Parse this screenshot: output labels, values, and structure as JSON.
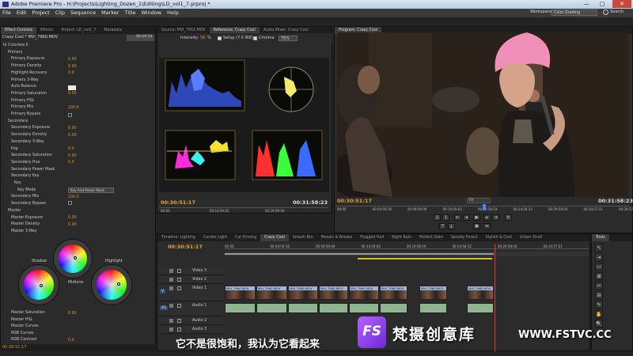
{
  "titlebar": {
    "title": "Adobe Premiere Pro - H:\\Projects\\Lighting_Dozen_1\\Editing\\LD_vol1_7.prproj *",
    "min": "—",
    "max": "□",
    "close": "✕"
  },
  "menu": [
    "File",
    "Edit",
    "Project",
    "Clip",
    "Sequence",
    "Marker",
    "Title",
    "Window",
    "Help"
  ],
  "workspace": {
    "label": "Workspace:",
    "value": "Color Grading",
    "search": "Search"
  },
  "effect_controls": {
    "tabs": [
      "Effect Controls",
      "Effects",
      "Project: LD_vol1_7",
      "Metadata"
    ],
    "clip": "Crazy Cool * MVI_7960.MOV",
    "ruler_time": "00:29:54",
    "rows": [
      {
        "label": "fx  Colorista II",
        "val": ""
      },
      {
        "label": "Primary",
        "val": ""
      },
      {
        "label": "Primary Exposure",
        "val": "0.00"
      },
      {
        "label": "Primary Density",
        "val": "0.00"
      },
      {
        "label": "Highlight Recovery",
        "val": "0.0"
      },
      {
        "label": "Primary 3-Way",
        "val": ""
      },
      {
        "label": "Auto Balance",
        "val": ""
      },
      {
        "label": "Primary Saturation",
        "val": "0.00"
      },
      {
        "label": "Primary HSL",
        "val": ""
      },
      {
        "label": "Primary Mix",
        "val": "100.0"
      },
      {
        "label": "Primary Bypass",
        "val": ""
      },
      {
        "label": "Secondary",
        "val": ""
      },
      {
        "label": "Secondary Exposure",
        "val": "0.00"
      },
      {
        "label": "Secondary Density",
        "val": "0.00"
      },
      {
        "label": "Secondary 3-Way",
        "val": ""
      },
      {
        "label": "Pop",
        "val": "0.0"
      },
      {
        "label": "Secondary Saturation",
        "val": "0.00"
      },
      {
        "label": "Secondary Hue",
        "val": "0.0"
      },
      {
        "label": "Secondary Power Mask",
        "val": ""
      },
      {
        "label": "Secondary Key",
        "val": ""
      },
      {
        "label": "Key",
        "val": ""
      },
      {
        "label": "Key Mode",
        "val": ""
      },
      {
        "label": "Secondary Mix",
        "val": "100.0"
      },
      {
        "label": "Secondary Bypass",
        "val": ""
      },
      {
        "label": "Master",
        "val": ""
      },
      {
        "label": "Master Exposure",
        "val": "0.00"
      },
      {
        "label": "Master Density",
        "val": "0.00"
      },
      {
        "label": "Master 3-Way",
        "val": ""
      }
    ],
    "key_mode_value": "Key And Power Mask",
    "wheels": {
      "shadow": "Shadow",
      "midtone": "Midtone",
      "highlight": "Highlight"
    },
    "bottom_rows": [
      {
        "label": "Master Saturation",
        "val": "0.00"
      },
      {
        "label": "Master HSL",
        "val": ""
      },
      {
        "label": "Master Curves",
        "val": ""
      },
      {
        "label": "RGB Curves",
        "val": ""
      },
      {
        "label": "RGB Contrast",
        "val": "0.0"
      }
    ],
    "time": "00:30:51:17"
  },
  "source": {
    "tabs": [
      "Source: MVI_7953.MOV",
      "Reference: Crazy Cool",
      "Audio Mixer: Crazy Cool"
    ],
    "intensity_label": "Intensity:",
    "intensity_value": "56",
    "intensity_unit": "%",
    "setup": "Setup (7.5 IRE)",
    "chroma": "Chroma",
    "zoom": "75%",
    "time": "00:30:51:17",
    "duration": "00:31:58:23",
    "ruler": [
      "00:00",
      "00:14:59:02",
      "00:29:59:04"
    ]
  },
  "program": {
    "tab": "Program: Crazy Cool",
    "time": "00:30:51:17",
    "duration": "00:31:58:23",
    "zoom": "Fit",
    "ruler": [
      "00:00",
      "00:04:59:16",
      "00:09:59:09",
      "00:14:59:02",
      "00:19:58:19",
      "00:24:58:12",
      "00:29:58:04",
      "00:34:57:21",
      "00:39:57:14"
    ]
  },
  "timeline": {
    "tabs": [
      "Timeline: Lighting",
      "Candle Light",
      "Car Driving",
      "Crazy Cool",
      "Smash Bro",
      "Mosaic & Breaks",
      "Flagged Hall",
      "Night Rain",
      "Perfect Date",
      "Spooky Forest",
      "Stylish & Cool",
      "Urban Stroll"
    ],
    "time": "00:30:51:17",
    "ruler": [
      "00:00",
      "00:04:59:16",
      "00:09:59:09",
      "00:14:59:02",
      "00:19:58:19",
      "00:24:58:12",
      "00:29:58:04",
      "00:34:57:21"
    ],
    "tracks": [
      "Video 3",
      "Video 2",
      "Video 1",
      "Audio 1",
      "Audio 2",
      "Audio 3"
    ],
    "clip_label": "MVI_7960.MOV",
    "track_labels": {
      "v1": "V",
      "a1": "A1"
    }
  },
  "tools_panel": {
    "tab": "Tools",
    "tools": [
      "↖",
      "⇥",
      "⇿",
      "⊞",
      "✂",
      "⊟",
      "✎",
      "✋",
      "🔍"
    ]
  },
  "subtitle": "它不是很饱和，我认为它看起来",
  "watermark": {
    "logo": "FS",
    "name": "梵摄创意库",
    "url": "WWW.FSTVC.CC"
  }
}
